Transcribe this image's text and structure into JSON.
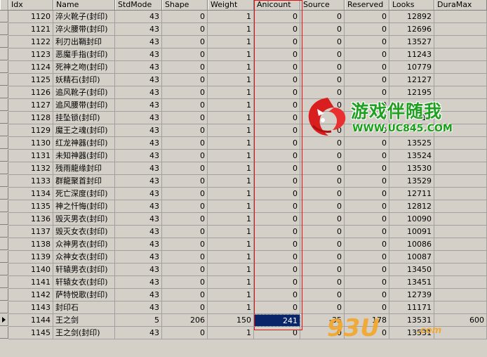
{
  "columns": [
    "Idx",
    "Name",
    "StdMode",
    "Shape",
    "Weight",
    "Anicount",
    "Source",
    "Reserved",
    "Looks",
    "DuraMax"
  ],
  "rows": [
    [
      "1120",
      "淬火靴子(封印)",
      "43",
      "0",
      "1",
      "0",
      "0",
      "0",
      "12892",
      ""
    ],
    [
      "1121",
      "淬火腰带(封印)",
      "43",
      "0",
      "1",
      "0",
      "0",
      "0",
      "12696",
      ""
    ],
    [
      "1122",
      "利刃出鞘封印",
      "43",
      "0",
      "1",
      "0",
      "0",
      "0",
      "13527",
      ""
    ],
    [
      "1123",
      "恶魔手指(封印)",
      "43",
      "0",
      "1",
      "0",
      "0",
      "0",
      "11243",
      ""
    ],
    [
      "1124",
      "死神之吻(封印)",
      "43",
      "0",
      "1",
      "0",
      "0",
      "0",
      "10779",
      ""
    ],
    [
      "1125",
      "妖精石(封印)",
      "43",
      "0",
      "1",
      "0",
      "0",
      "0",
      "12127",
      ""
    ],
    [
      "1126",
      "追风靴子(封印)",
      "43",
      "0",
      "1",
      "0",
      "0",
      "0",
      "12195",
      ""
    ],
    [
      "1127",
      "追风腰带(封印)",
      "43",
      "0",
      "1",
      "0",
      "0",
      "0",
      "",
      ""
    ],
    [
      "1128",
      "挂坠锁(封印)",
      "43",
      "0",
      "1",
      "0",
      "0",
      "0",
      "13",
      ""
    ],
    [
      "1129",
      "魔王之魂(封印)",
      "43",
      "0",
      "1",
      "0",
      "0",
      "0",
      "",
      ""
    ],
    [
      "1130",
      "红龙神器(封印)",
      "43",
      "0",
      "1",
      "0",
      "0",
      "0",
      "13525",
      ""
    ],
    [
      "1131",
      "未知神器(封印)",
      "43",
      "0",
      "1",
      "0",
      "0",
      "0",
      "13524",
      ""
    ],
    [
      "1132",
      "残雨龍缘封印",
      "43",
      "0",
      "1",
      "0",
      "0",
      "0",
      "13530",
      ""
    ],
    [
      "1133",
      "群龍聚首封印",
      "43",
      "0",
      "1",
      "0",
      "0",
      "0",
      "13529",
      ""
    ],
    [
      "1134",
      "死亡深度(封印)",
      "43",
      "0",
      "1",
      "0",
      "0",
      "0",
      "12711",
      ""
    ],
    [
      "1135",
      "神之忏悔(封印)",
      "43",
      "0",
      "1",
      "0",
      "0",
      "0",
      "12812",
      ""
    ],
    [
      "1136",
      "毁灭男衣(封印)",
      "43",
      "0",
      "1",
      "0",
      "0",
      "0",
      "10090",
      ""
    ],
    [
      "1137",
      "毁灭女衣(封印)",
      "43",
      "0",
      "1",
      "0",
      "0",
      "0",
      "10091",
      ""
    ],
    [
      "1138",
      "众神男衣(封印)",
      "43",
      "0",
      "1",
      "0",
      "0",
      "0",
      "10086",
      ""
    ],
    [
      "1139",
      "众神女衣(封印)",
      "43",
      "0",
      "1",
      "0",
      "0",
      "0",
      "10087",
      ""
    ],
    [
      "1140",
      "轩辕男衣(封印)",
      "43",
      "0",
      "1",
      "0",
      "0",
      "0",
      "13450",
      ""
    ],
    [
      "1141",
      "轩辕女衣(封印)",
      "43",
      "0",
      "1",
      "0",
      "0",
      "0",
      "13451",
      ""
    ],
    [
      "1142",
      "萨特悦歌(封印)",
      "43",
      "0",
      "1",
      "0",
      "0",
      "0",
      "12739",
      ""
    ],
    [
      "1143",
      "封印石",
      "43",
      "0",
      "1",
      "0",
      "0",
      "0",
      "11171",
      ""
    ],
    [
      "1144",
      "王之剑",
      "5",
      "206",
      "150",
      "241",
      "-35",
      "178",
      "13531",
      "600"
    ],
    [
      "1145",
      "王之剑(封印)",
      "43",
      "0",
      "1",
      "0",
      "0",
      "0",
      "13531",
      ""
    ]
  ],
  "current_row_index": 24,
  "selected_cell_text": "241",
  "watermark_top": {
    "title": "游戏伴随我",
    "url": "WWW.UC845.COM"
  },
  "watermark_bottom": {
    "big": "93U",
    "small": ".com"
  },
  "colors": {
    "selection": "#0a246a",
    "highlight_box": "#e01010",
    "grid_face": "#d4d0c8"
  }
}
